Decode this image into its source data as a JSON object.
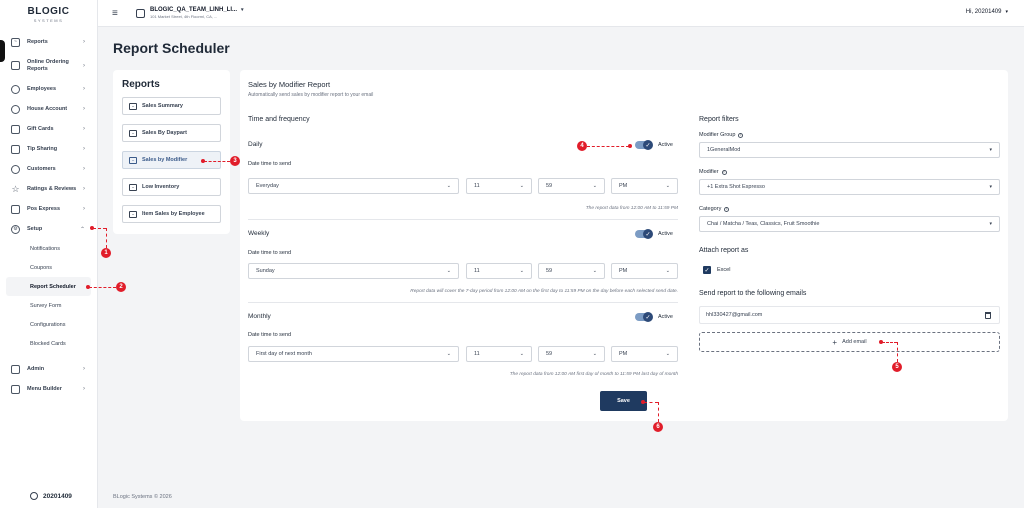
{
  "sidebar": {
    "logo_main": "BLOGIC",
    "logo_sub": "SYSTEMS",
    "items": [
      {
        "label": "Reports",
        "icon": "chart-icon"
      },
      {
        "label": "Online Ordering Reports",
        "icon": "document-icon"
      },
      {
        "label": "Employees",
        "icon": "users-icon"
      },
      {
        "label": "House Account",
        "icon": "user-circle-icon"
      },
      {
        "label": "Gift Cards",
        "icon": "gift-icon"
      },
      {
        "label": "Tip Sharing",
        "icon": "tag-icon"
      },
      {
        "label": "Customers",
        "icon": "customers-icon"
      },
      {
        "label": "Ratings & Reviews",
        "icon": "star-icon"
      },
      {
        "label": "Pos Express",
        "icon": "pos-icon"
      },
      {
        "label": "Setup",
        "icon": "gear-icon"
      },
      {
        "label": "Admin",
        "icon": "shield-icon"
      },
      {
        "label": "Menu Builder",
        "icon": "grid-icon"
      }
    ],
    "setup_sub": [
      "Notifications",
      "Coupons",
      "Report Scheduler",
      "Survey Form",
      "Configurations",
      "Blocked Cards"
    ],
    "footer_user": "20201409"
  },
  "topbar": {
    "store_name": "BLOGIC_QA_TEAM_LINH_LI...",
    "store_address": "101 Market Street, 4th Floorml, CA, ...",
    "greeting": "Hi, 20201409"
  },
  "page_title": "Report Scheduler",
  "reports_panel": {
    "title": "Reports",
    "items": [
      "Sales Summary",
      "Sales By Daypart",
      "Sales by Modifier",
      "Low Inventory",
      "Item Sales by Employee"
    ]
  },
  "main": {
    "title": "Sales by Modifier Report",
    "subtitle": "Automatically send sales by modifier report to your email",
    "time_freq_title": "Time and frequency",
    "date_time_label": "Date time to send",
    "active_label": "Active",
    "daily": {
      "title": "Daily",
      "day": "Everyday",
      "hour": "11",
      "minute": "59",
      "ampm": "PM",
      "note": "The report data from 12:00 AM to 11:59 PM"
    },
    "weekly": {
      "title": "Weekly",
      "day": "Sunday",
      "hour": "11",
      "minute": "59",
      "ampm": "PM",
      "note": "Report data will cover the 7-day period from 12:00 AM on the first day to 11:59 PM on the day before each selected send date."
    },
    "monthly": {
      "title": "Monthly",
      "day": "First day of next month",
      "hour": "11",
      "minute": "59",
      "ampm": "PM",
      "note": "The report data from 12:00 AM first day of month to 11:59 PM last day of month"
    },
    "filters": {
      "title": "Report filters",
      "modifier_group_label": "Modifier Group",
      "modifier_group_value": "1GeneralMod",
      "modifier_label": "Modifier",
      "modifier_value": "+1 Extra Shot Espresso",
      "category_label": "Category",
      "category_value": "Chai / Matcha / Teas, Classics, Fruit Smoothie"
    },
    "attach_title": "Attach report as",
    "attach_excel": "Excel",
    "emails_title": "Send report to the following emails",
    "email": "hhl330427@gmail.com",
    "add_email": "Add email",
    "save": "Save"
  },
  "footer": "BLogic Systems © 2026",
  "annotations": [
    "1",
    "2",
    "3",
    "4",
    "5",
    "6"
  ],
  "colors": {
    "accent": "#1f3a60",
    "annotation": "#e11d2a",
    "toggle_track": "#7c9cc4"
  }
}
